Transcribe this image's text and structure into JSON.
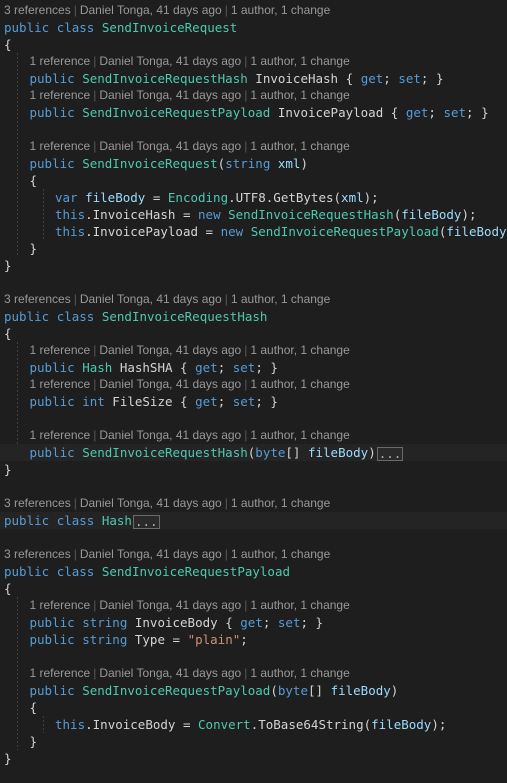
{
  "editor": {
    "language": "csharp",
    "theme": "dark-plus",
    "background": "#1e1e1e",
    "colors": {
      "keyword": "#569cd6",
      "type": "#4ec9b0",
      "identifier": "#d4d4d4",
      "string": "#ce9178",
      "codelens": "#999999",
      "highlight_row": "#242424",
      "fold_border": "#6a6a6a"
    }
  },
  "codelens": {
    "three_references": "3 references",
    "one_reference": "1 reference",
    "author_date": "Daniel Tonga, 41 days ago",
    "authors_changes": "1 author, 1 change",
    "separator": "|"
  },
  "fold_placeholder": "...",
  "lines": [
    {
      "n": 1,
      "indent": 0,
      "type": "codelens",
      "refs": "3 references"
    },
    {
      "n": 2,
      "indent": 0,
      "type": "code",
      "text": "public class SendInvoiceRequest"
    },
    {
      "n": 3,
      "indent": 0,
      "type": "code",
      "text": "{"
    },
    {
      "n": 4,
      "indent": 1,
      "type": "codelens",
      "refs": "1 reference"
    },
    {
      "n": 5,
      "indent": 1,
      "type": "code",
      "text": "public SendInvoiceRequestHash InvoiceHash { get; set; }"
    },
    {
      "n": 6,
      "indent": 1,
      "type": "codelens",
      "refs": "1 reference"
    },
    {
      "n": 7,
      "indent": 1,
      "type": "code",
      "text": "public SendInvoiceRequestPayload InvoicePayload { get; set; }"
    },
    {
      "n": 8,
      "indent": 1,
      "type": "blank",
      "text": ""
    },
    {
      "n": 9,
      "indent": 1,
      "type": "codelens",
      "refs": "1 reference"
    },
    {
      "n": 10,
      "indent": 1,
      "type": "code",
      "text": "public SendInvoiceRequest(string xml)"
    },
    {
      "n": 11,
      "indent": 1,
      "type": "code",
      "text": "{"
    },
    {
      "n": 12,
      "indent": 2,
      "type": "code",
      "text": "var fileBody = Encoding.UTF8.GetBytes(xml);"
    },
    {
      "n": 13,
      "indent": 2,
      "type": "code",
      "text": "this.InvoiceHash = new SendInvoiceRequestHash(fileBody);"
    },
    {
      "n": 14,
      "indent": 2,
      "type": "code",
      "text": "this.InvoicePayload = new SendInvoiceRequestPayload(fileBody);"
    },
    {
      "n": 15,
      "indent": 1,
      "type": "code",
      "text": "}"
    },
    {
      "n": 16,
      "indent": 0,
      "type": "code",
      "text": "}"
    },
    {
      "n": 17,
      "indent": 0,
      "type": "blank",
      "text": ""
    },
    {
      "n": 18,
      "indent": 0,
      "type": "codelens",
      "refs": "3 references"
    },
    {
      "n": 19,
      "indent": 0,
      "type": "code",
      "text": "public class SendInvoiceRequestHash"
    },
    {
      "n": 20,
      "indent": 0,
      "type": "code",
      "text": "{"
    },
    {
      "n": 21,
      "indent": 1,
      "type": "codelens",
      "refs": "1 reference"
    },
    {
      "n": 22,
      "indent": 1,
      "type": "code",
      "text": "public Hash HashSHA { get; set; }"
    },
    {
      "n": 23,
      "indent": 1,
      "type": "codelens",
      "refs": "1 reference"
    },
    {
      "n": 24,
      "indent": 1,
      "type": "code",
      "text": "public int FileSize { get; set; }"
    },
    {
      "n": 25,
      "indent": 1,
      "type": "blank",
      "text": ""
    },
    {
      "n": 26,
      "indent": 1,
      "type": "codelens",
      "refs": "1 reference"
    },
    {
      "n": 27,
      "indent": 1,
      "type": "code-folded",
      "text": "public SendInvoiceRequestHash(byte[] fileBody)"
    },
    {
      "n": 28,
      "indent": 0,
      "type": "code",
      "text": "}"
    },
    {
      "n": 29,
      "indent": 0,
      "type": "blank",
      "text": ""
    },
    {
      "n": 30,
      "indent": 0,
      "type": "codelens",
      "refs": "3 references"
    },
    {
      "n": 31,
      "indent": 0,
      "type": "code-folded",
      "text": "public class Hash"
    },
    {
      "n": 32,
      "indent": 0,
      "type": "blank",
      "text": ""
    },
    {
      "n": 33,
      "indent": 0,
      "type": "codelens",
      "refs": "3 references"
    },
    {
      "n": 34,
      "indent": 0,
      "type": "code",
      "text": "public class SendInvoiceRequestPayload"
    },
    {
      "n": 35,
      "indent": 0,
      "type": "code",
      "text": "{"
    },
    {
      "n": 36,
      "indent": 1,
      "type": "codelens",
      "refs": "1 reference"
    },
    {
      "n": 37,
      "indent": 1,
      "type": "code",
      "text": "public string InvoiceBody { get; set; }"
    },
    {
      "n": 38,
      "indent": 1,
      "type": "code",
      "text": "public string Type = \"plain\";"
    },
    {
      "n": 39,
      "indent": 1,
      "type": "blank",
      "text": ""
    },
    {
      "n": 40,
      "indent": 1,
      "type": "codelens",
      "refs": "1 reference"
    },
    {
      "n": 41,
      "indent": 1,
      "type": "code",
      "text": "public SendInvoiceRequestPayload(byte[] fileBody)"
    },
    {
      "n": 42,
      "indent": 1,
      "type": "code",
      "text": "{"
    },
    {
      "n": 43,
      "indent": 2,
      "type": "code",
      "text": "this.InvoiceBody = Convert.ToBase64String(fileBody);"
    },
    {
      "n": 44,
      "indent": 1,
      "type": "code",
      "text": "}"
    },
    {
      "n": 45,
      "indent": 0,
      "type": "code",
      "text": "}"
    }
  ],
  "code_rows": {
    "r2": [
      [
        "kw",
        "public"
      ],
      [
        "punc",
        " "
      ],
      [
        "kw",
        "class"
      ],
      [
        "punc",
        " "
      ],
      [
        "type",
        "SendInvoiceRequest"
      ]
    ],
    "r3": [
      [
        "brace",
        "{"
      ]
    ],
    "r5": [
      [
        "kw",
        "public"
      ],
      [
        "punc",
        " "
      ],
      [
        "type",
        "SendInvoiceRequestHash"
      ],
      [
        "punc",
        " "
      ],
      [
        "ident",
        "InvoiceHash"
      ],
      [
        "punc",
        " "
      ],
      [
        "brace",
        "{"
      ],
      [
        "punc",
        " "
      ],
      [
        "kw",
        "get"
      ],
      [
        "punc",
        "; "
      ],
      [
        "kw",
        "set"
      ],
      [
        "punc",
        "; "
      ],
      [
        "brace",
        "}"
      ]
    ],
    "r7": [
      [
        "kw",
        "public"
      ],
      [
        "punc",
        " "
      ],
      [
        "type",
        "SendInvoiceRequestPayload"
      ],
      [
        "punc",
        " "
      ],
      [
        "ident",
        "InvoicePayload"
      ],
      [
        "punc",
        " "
      ],
      [
        "brace",
        "{"
      ],
      [
        "punc",
        " "
      ],
      [
        "kw",
        "get"
      ],
      [
        "punc",
        "; "
      ],
      [
        "kw",
        "set"
      ],
      [
        "punc",
        "; "
      ],
      [
        "brace",
        "}"
      ]
    ],
    "r10": [
      [
        "kw",
        "public"
      ],
      [
        "punc",
        " "
      ],
      [
        "type",
        "SendInvoiceRequest"
      ],
      [
        "punc",
        "("
      ],
      [
        "kw",
        "string"
      ],
      [
        "punc",
        " "
      ],
      [
        "param",
        "xml"
      ],
      [
        "punc",
        ")"
      ]
    ],
    "r11": [
      [
        "brace",
        "{"
      ]
    ],
    "r12": [
      [
        "kw",
        "var"
      ],
      [
        "punc",
        " "
      ],
      [
        "param",
        "fileBody"
      ],
      [
        "punc",
        " = "
      ],
      [
        "type",
        "Encoding"
      ],
      [
        "punc",
        "."
      ],
      [
        "ident",
        "UTF8"
      ],
      [
        "punc",
        "."
      ],
      [
        "ident",
        "GetBytes"
      ],
      [
        "punc",
        "("
      ],
      [
        "param",
        "xml"
      ],
      [
        "punc",
        ");"
      ]
    ],
    "r13": [
      [
        "kw",
        "this"
      ],
      [
        "punc",
        "."
      ],
      [
        "ident",
        "InvoiceHash"
      ],
      [
        "punc",
        " = "
      ],
      [
        "kw",
        "new"
      ],
      [
        "punc",
        " "
      ],
      [
        "type",
        "SendInvoiceRequestHash"
      ],
      [
        "punc",
        "("
      ],
      [
        "param",
        "fileBody"
      ],
      [
        "punc",
        ");"
      ]
    ],
    "r14": [
      [
        "kw",
        "this"
      ],
      [
        "punc",
        "."
      ],
      [
        "ident",
        "InvoicePayload"
      ],
      [
        "punc",
        " = "
      ],
      [
        "kw",
        "new"
      ],
      [
        "punc",
        " "
      ],
      [
        "type",
        "SendInvoiceRequestPayload"
      ],
      [
        "punc",
        "("
      ],
      [
        "param",
        "fileBody"
      ],
      [
        "punc",
        ");"
      ]
    ],
    "r15": [
      [
        "brace",
        "}"
      ]
    ],
    "r16": [
      [
        "brace",
        "}"
      ]
    ],
    "r19": [
      [
        "kw",
        "public"
      ],
      [
        "punc",
        " "
      ],
      [
        "kw",
        "class"
      ],
      [
        "punc",
        " "
      ],
      [
        "type",
        "SendInvoiceRequestHash"
      ]
    ],
    "r20": [
      [
        "brace",
        "{"
      ]
    ],
    "r22": [
      [
        "kw",
        "public"
      ],
      [
        "punc",
        " "
      ],
      [
        "type",
        "Hash"
      ],
      [
        "punc",
        " "
      ],
      [
        "ident",
        "HashSHA"
      ],
      [
        "punc",
        " "
      ],
      [
        "brace",
        "{"
      ],
      [
        "punc",
        " "
      ],
      [
        "kw",
        "get"
      ],
      [
        "punc",
        "; "
      ],
      [
        "kw",
        "set"
      ],
      [
        "punc",
        "; "
      ],
      [
        "brace",
        "}"
      ]
    ],
    "r24": [
      [
        "kw",
        "public"
      ],
      [
        "punc",
        " "
      ],
      [
        "kw",
        "int"
      ],
      [
        "punc",
        " "
      ],
      [
        "ident",
        "FileSize"
      ],
      [
        "punc",
        " "
      ],
      [
        "brace",
        "{"
      ],
      [
        "punc",
        " "
      ],
      [
        "kw",
        "get"
      ],
      [
        "punc",
        "; "
      ],
      [
        "kw",
        "set"
      ],
      [
        "punc",
        "; "
      ],
      [
        "brace",
        "}"
      ]
    ],
    "r27": [
      [
        "kw",
        "public"
      ],
      [
        "punc",
        " "
      ],
      [
        "type",
        "SendInvoiceRequestHash"
      ],
      [
        "punc",
        "("
      ],
      [
        "kw",
        "byte"
      ],
      [
        "punc",
        "[] "
      ],
      [
        "param",
        "fileBody"
      ],
      [
        "punc",
        ")"
      ]
    ],
    "r28": [
      [
        "brace",
        "}"
      ]
    ],
    "r31": [
      [
        "kw",
        "public"
      ],
      [
        "punc",
        " "
      ],
      [
        "kw",
        "class"
      ],
      [
        "punc",
        " "
      ],
      [
        "type",
        "Hash"
      ]
    ],
    "r34": [
      [
        "kw",
        "public"
      ],
      [
        "punc",
        " "
      ],
      [
        "kw",
        "class"
      ],
      [
        "punc",
        " "
      ],
      [
        "type",
        "SendInvoiceRequestPayload"
      ]
    ],
    "r35": [
      [
        "brace",
        "{"
      ]
    ],
    "r37": [
      [
        "kw",
        "public"
      ],
      [
        "punc",
        " "
      ],
      [
        "kw",
        "string"
      ],
      [
        "punc",
        " "
      ],
      [
        "ident",
        "InvoiceBody"
      ],
      [
        "punc",
        " "
      ],
      [
        "brace",
        "{"
      ],
      [
        "punc",
        " "
      ],
      [
        "kw",
        "get"
      ],
      [
        "punc",
        "; "
      ],
      [
        "kw",
        "set"
      ],
      [
        "punc",
        "; "
      ],
      [
        "brace",
        "}"
      ]
    ],
    "r38": [
      [
        "kw",
        "public"
      ],
      [
        "punc",
        " "
      ],
      [
        "kw",
        "string"
      ],
      [
        "punc",
        " "
      ],
      [
        "ident",
        "Type"
      ],
      [
        "punc",
        " = "
      ],
      [
        "str",
        "\"plain\""
      ],
      [
        "punc",
        ";"
      ]
    ],
    "r41": [
      [
        "kw",
        "public"
      ],
      [
        "punc",
        " "
      ],
      [
        "type",
        "SendInvoiceRequestPayload"
      ],
      [
        "punc",
        "("
      ],
      [
        "kw",
        "byte"
      ],
      [
        "punc",
        "[] "
      ],
      [
        "param",
        "fileBody"
      ],
      [
        "punc",
        ")"
      ]
    ],
    "r42": [
      [
        "brace",
        "{"
      ]
    ],
    "r43": [
      [
        "kw",
        "this"
      ],
      [
        "punc",
        "."
      ],
      [
        "ident",
        "InvoiceBody"
      ],
      [
        "punc",
        " = "
      ],
      [
        "type",
        "Convert"
      ],
      [
        "punc",
        "."
      ],
      [
        "ident",
        "ToBase64String"
      ],
      [
        "punc",
        "("
      ],
      [
        "param",
        "fileBody"
      ],
      [
        "punc",
        ");"
      ]
    ],
    "r44": [
      [
        "brace",
        "}"
      ]
    ],
    "r45": [
      [
        "brace",
        "}"
      ]
    ]
  }
}
